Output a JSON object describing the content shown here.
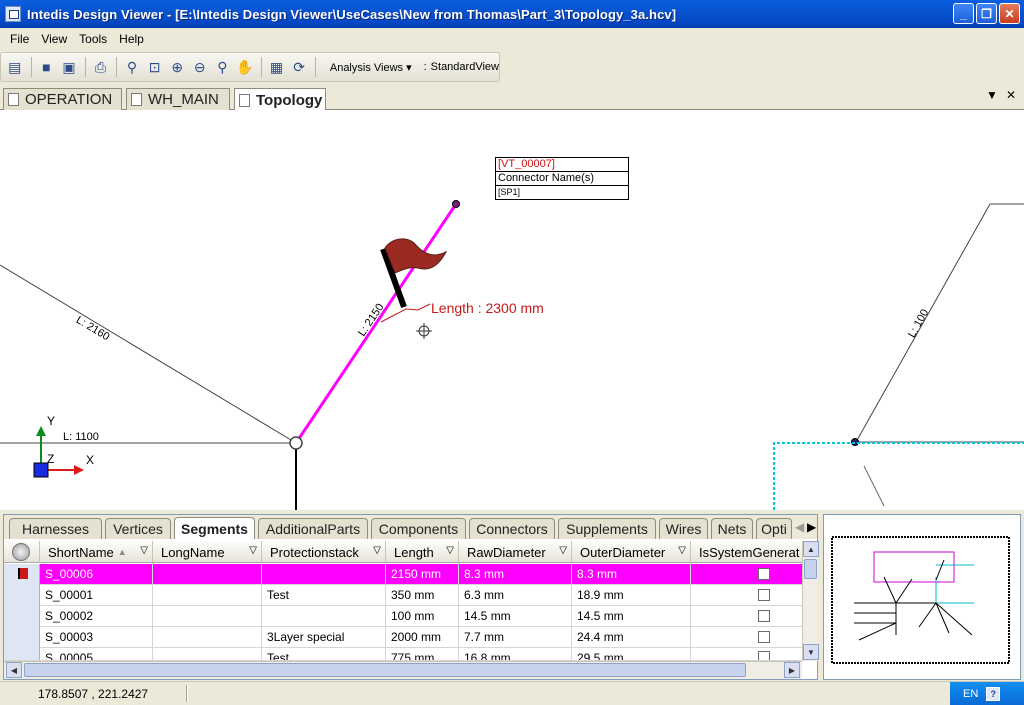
{
  "window": {
    "title": "Intedis Design Viewer - [E:\\Intedis Design Viewer\\UseCases\\New from Thomas\\Part_3\\Topology_3a.hcv]",
    "minimize": "_",
    "restore": "❐",
    "close": "✕"
  },
  "menu": [
    "File",
    "View",
    "Tools",
    "Help"
  ],
  "toolbar": {
    "analysis_views": "Analysis Views ▾",
    "view_separator": ":",
    "standard_view": "StandardView"
  },
  "doc_tabs": [
    {
      "label": "OPERATION",
      "active": false
    },
    {
      "label": "WH_MAIN",
      "active": false
    },
    {
      "label": "Topology",
      "active": true
    }
  ],
  "doc_controls": {
    "dropdown": "▼",
    "close": "✕"
  },
  "canvas": {
    "vt_box": {
      "id": "[VT_00007]",
      "name": "Connector Name(s)",
      "sp": "[SP1]"
    },
    "length_annotation": "Length : 2300 mm",
    "segment_labels": {
      "left": "L: 2160",
      "center": "L: 2150",
      "right": "L: 100",
      "axis": "L: 1100"
    },
    "axis": {
      "y": "Y",
      "x": "X",
      "z": "Z"
    }
  },
  "grid": {
    "tabs": [
      "Harnesses",
      "Vertices",
      "Segments",
      "AdditionalParts",
      "Components",
      "Connectors",
      "Supplements",
      "Wires",
      "Nets",
      "Opti"
    ],
    "active_tab": "Segments",
    "columns": [
      "ShortName",
      "LongName",
      "Protectionstack",
      "Length",
      "RawDiameter",
      "OuterDiameter",
      "IsSystemGenerat"
    ],
    "rows": [
      {
        "short": "S_00006",
        "long": "",
        "prot": "",
        "length": "2150 mm",
        "raw": "8.3 mm",
        "outer": "8.3 mm",
        "sys": false,
        "selected": true
      },
      {
        "short": "S_00001",
        "long": "",
        "prot": "Test",
        "length": "350 mm",
        "raw": "6.3 mm",
        "outer": "18.9 mm",
        "sys": false,
        "selected": false
      },
      {
        "short": "S_00002",
        "long": "",
        "prot": "",
        "length": "100 mm",
        "raw": "14.5 mm",
        "outer": "14.5 mm",
        "sys": false,
        "selected": false
      },
      {
        "short": "S_00003",
        "long": "",
        "prot": "3Layer special",
        "length": "2000 mm",
        "raw": "7.7 mm",
        "outer": "24.4 mm",
        "sys": false,
        "selected": false
      },
      {
        "short": "S_00005",
        "long": "",
        "prot": "Test",
        "length": "775 mm",
        "raw": "16.8 mm",
        "outer": "29.5 mm",
        "sys": false,
        "selected": false
      }
    ]
  },
  "status": {
    "coords": "178.8507 , 221.2427",
    "lang": "EN",
    "help": "?"
  },
  "colors": {
    "selection": "#ff00ff",
    "flag": "#9b2a22",
    "annotation": "#c81a1a",
    "titlebar": "#0853d0"
  }
}
